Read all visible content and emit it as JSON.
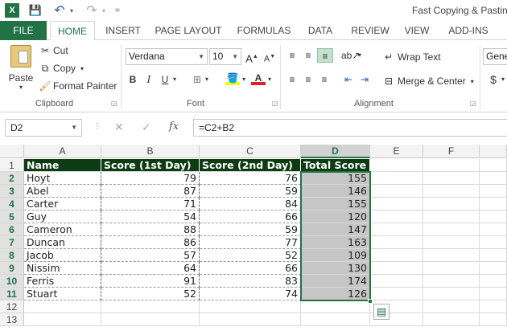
{
  "app": {
    "title": "Fast Copying & Pasting"
  },
  "qat": {
    "excel_logo": "X",
    "save": "💾",
    "undo": "↶",
    "redo": "↷",
    "customize": "="
  },
  "tabs": [
    "FILE",
    "HOME",
    "INSERT",
    "PAGE LAYOUT",
    "FORMULAS",
    "DATA",
    "REVIEW",
    "VIEW",
    "ADD-INS"
  ],
  "ribbon": {
    "clipboard": {
      "label": "Clipboard",
      "paste": "Paste",
      "cut": "Cut",
      "copy": "Copy",
      "format_painter": "Format Painter"
    },
    "font": {
      "label": "Font",
      "font_name": "Verdana",
      "font_size": "10",
      "bold": "B",
      "italic": "I",
      "underline": "U"
    },
    "alignment": {
      "label": "Alignment",
      "wrap_text": "Wrap Text",
      "merge_center": "Merge & Center"
    },
    "number": {
      "format": "Gene",
      "currency": "$"
    }
  },
  "formula_bar": {
    "name_box": "D2",
    "fx": "fx",
    "formula": "=C2+B2"
  },
  "sheet": {
    "columns": [
      "A",
      "B",
      "C",
      "D",
      "E",
      "F"
    ],
    "selected_column": "D",
    "row_numbers": [
      "1",
      "2",
      "3",
      "4",
      "5",
      "6",
      "7",
      "8",
      "9",
      "10",
      "11",
      "12",
      "13"
    ],
    "headers": [
      "Name",
      "Score (1st Day)",
      "Score (2nd Day)",
      "Total Score"
    ],
    "rows": [
      [
        "Hoyt",
        "79",
        "76",
        "155"
      ],
      [
        "Abel",
        "87",
        "59",
        "146"
      ],
      [
        "Carter",
        "71",
        "84",
        "155"
      ],
      [
        "Guy",
        "54",
        "66",
        "120"
      ],
      [
        "Cameron",
        "88",
        "59",
        "147"
      ],
      [
        "Duncan",
        "86",
        "77",
        "163"
      ],
      [
        "Jacob",
        "57",
        "52",
        "109"
      ],
      [
        "Nissim",
        "64",
        "66",
        "130"
      ],
      [
        "Ferris",
        "91",
        "83",
        "174"
      ],
      [
        "Stuart",
        "52",
        "74",
        "126"
      ]
    ]
  },
  "colors": {
    "excel_green": "#217346",
    "header_fill": "#0d3b12",
    "selection_fill": "#c6c6c6"
  }
}
